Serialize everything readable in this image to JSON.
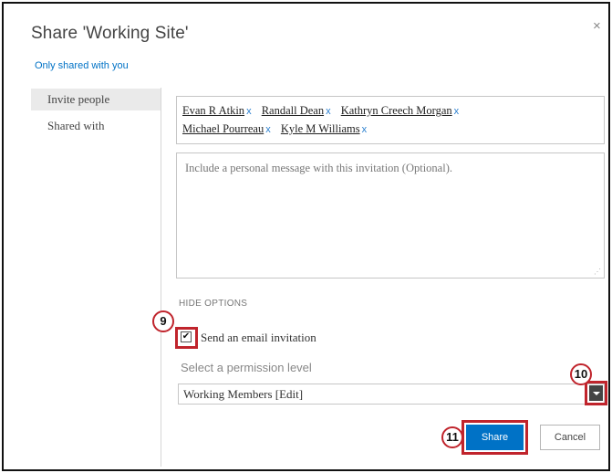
{
  "dialog": {
    "title": "Share 'Working Site'",
    "close_glyph": "×",
    "shared_link": "Only shared with you"
  },
  "sidebar": {
    "items": [
      {
        "label": "Invite people",
        "active": true
      },
      {
        "label": "Shared with",
        "active": false
      }
    ]
  },
  "invite": {
    "people": [
      {
        "name": "Evan R Atkin",
        "remove": "x"
      },
      {
        "name": "Randall Dean",
        "remove": "x"
      },
      {
        "name": "Kathryn Creech Morgan",
        "remove": "x"
      },
      {
        "name": "Michael Pourreau",
        "remove": "x"
      },
      {
        "name": "Kyle M Williams",
        "remove": "x"
      }
    ],
    "message_placeholder": "Include a personal message with this invitation (Optional)."
  },
  "options": {
    "toggle_label": "HIDE OPTIONS",
    "email_checkbox": {
      "label": "Send an email invitation",
      "checked": true,
      "glyph": "✔"
    },
    "permission": {
      "label": "Select a permission level",
      "selected": "Working Members [Edit]"
    }
  },
  "buttons": {
    "share": "Share",
    "cancel": "Cancel"
  },
  "callouts": [
    "9",
    "10",
    "11"
  ],
  "colors": {
    "accent": "#0072c6",
    "highlight": "#c0242c",
    "active_item": "#eaeaea"
  }
}
